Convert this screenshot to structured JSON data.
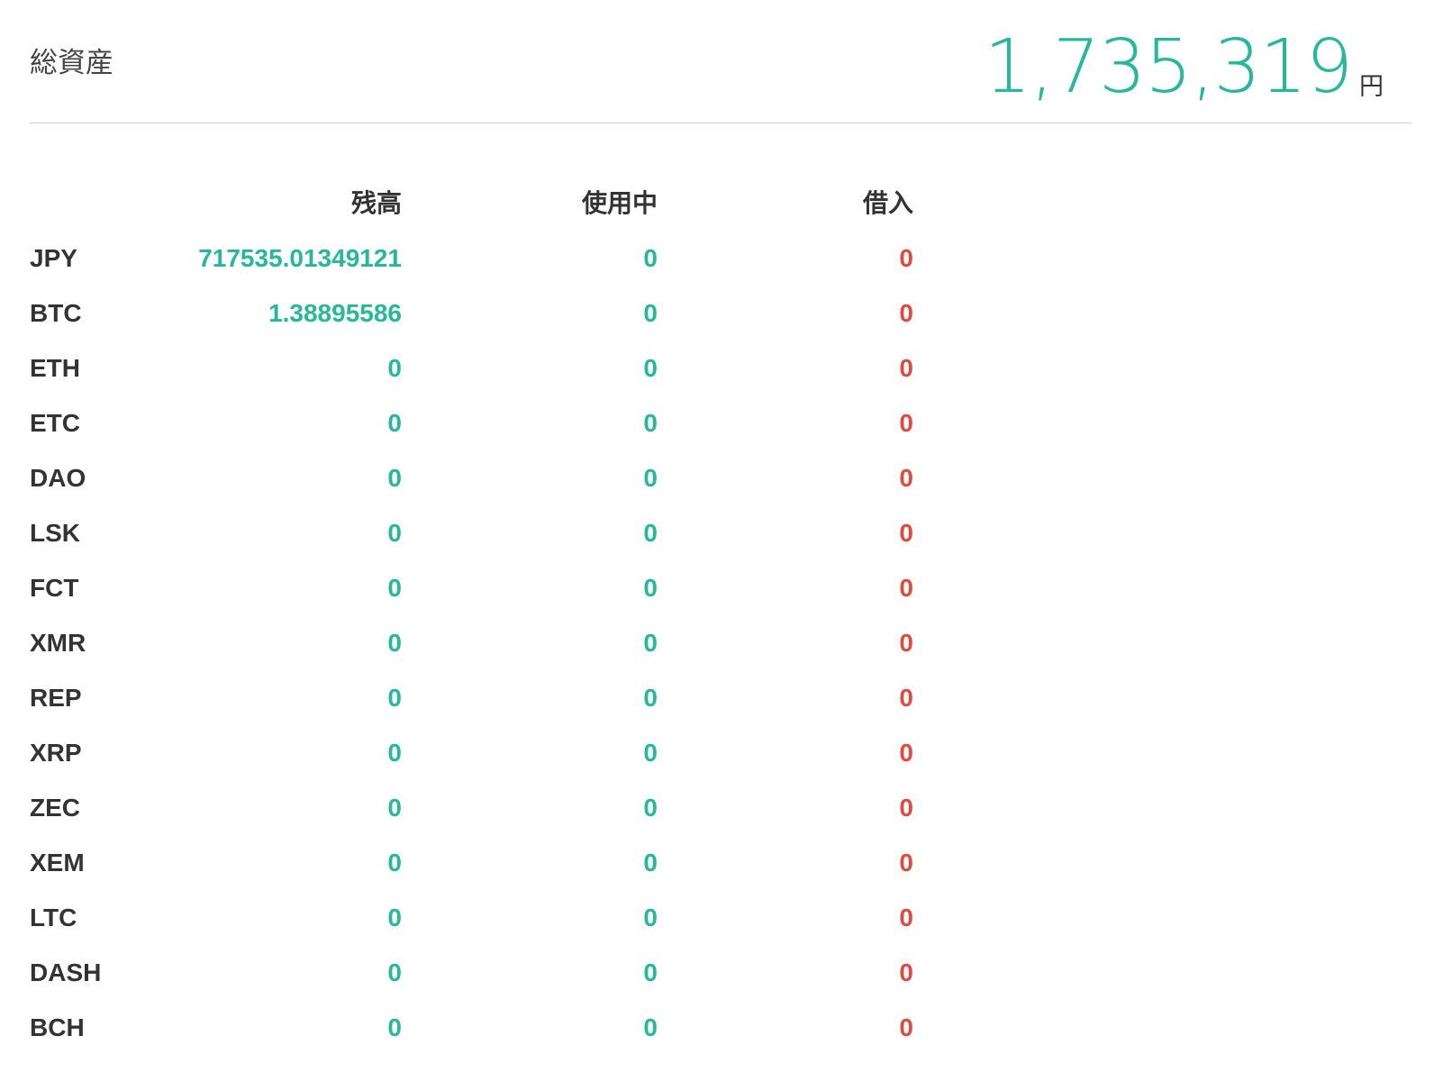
{
  "header": {
    "title": "総資産",
    "total_value": "1,735,319",
    "total_unit": "円"
  },
  "table": {
    "columns": {
      "balance": "残高",
      "in_use": "使用中",
      "borrowed": "借入"
    },
    "rows": [
      {
        "currency": "JPY",
        "balance": "717535.01349121",
        "in_use": "0",
        "borrowed": "0"
      },
      {
        "currency": "BTC",
        "balance": "1.38895586",
        "in_use": "0",
        "borrowed": "0"
      },
      {
        "currency": "ETH",
        "balance": "0",
        "in_use": "0",
        "borrowed": "0"
      },
      {
        "currency": "ETC",
        "balance": "0",
        "in_use": "0",
        "borrowed": "0"
      },
      {
        "currency": "DAO",
        "balance": "0",
        "in_use": "0",
        "borrowed": "0"
      },
      {
        "currency": "LSK",
        "balance": "0",
        "in_use": "0",
        "borrowed": "0"
      },
      {
        "currency": "FCT",
        "balance": "0",
        "in_use": "0",
        "borrowed": "0"
      },
      {
        "currency": "XMR",
        "balance": "0",
        "in_use": "0",
        "borrowed": "0"
      },
      {
        "currency": "REP",
        "balance": "0",
        "in_use": "0",
        "borrowed": "0"
      },
      {
        "currency": "XRP",
        "balance": "0",
        "in_use": "0",
        "borrowed": "0"
      },
      {
        "currency": "ZEC",
        "balance": "0",
        "in_use": "0",
        "borrowed": "0"
      },
      {
        "currency": "XEM",
        "balance": "0",
        "in_use": "0",
        "borrowed": "0"
      },
      {
        "currency": "LTC",
        "balance": "0",
        "in_use": "0",
        "borrowed": "0"
      },
      {
        "currency": "DASH",
        "balance": "0",
        "in_use": "0",
        "borrowed": "0"
      },
      {
        "currency": "BCH",
        "balance": "0",
        "in_use": "0",
        "borrowed": "0"
      }
    ]
  },
  "colors": {
    "positive": "#26b89a",
    "borrowed": "#e04a3f",
    "text": "#333333",
    "divider": "#cccccc"
  }
}
